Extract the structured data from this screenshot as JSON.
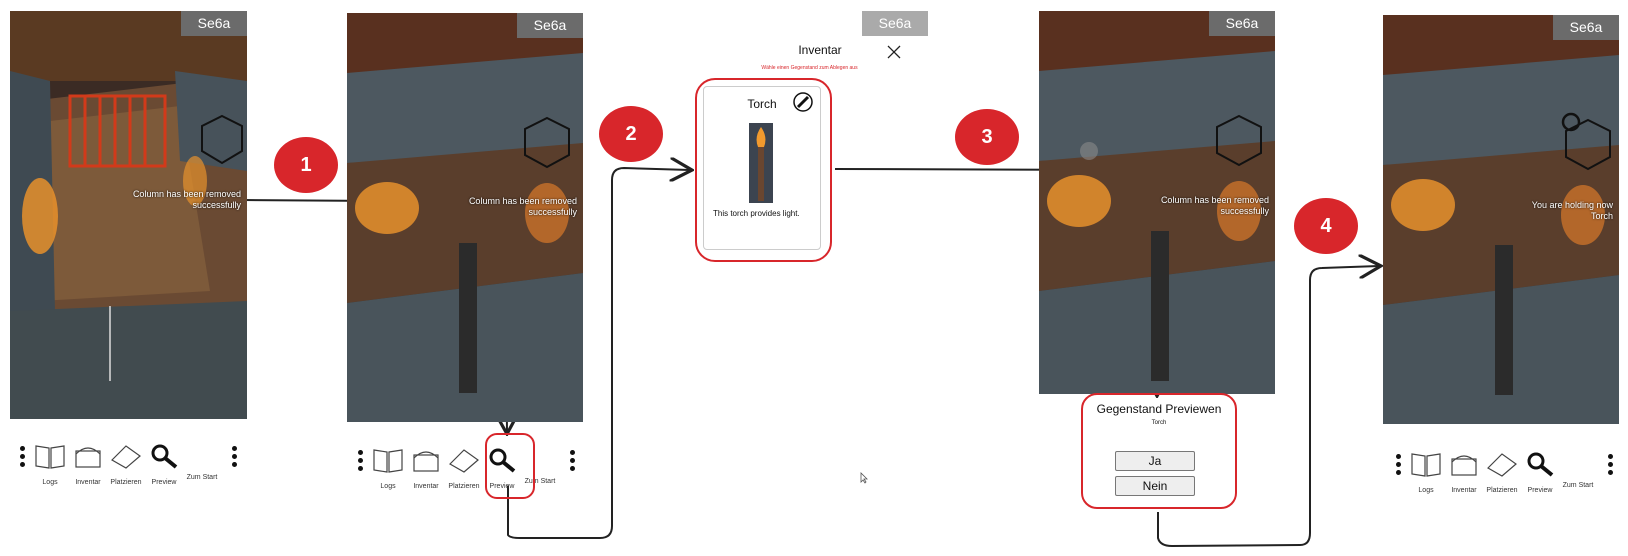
{
  "app_badge": "Se6a",
  "messages": {
    "column_removed": "Column has been removed successfully",
    "holding_torch": "You are holding now Torch"
  },
  "toolbar": {
    "logs": "Logs",
    "inventar": "Inventar",
    "platzieren": "Platzieren",
    "preview": "Preview",
    "zum_start": "Zum Start"
  },
  "steps": [
    "1",
    "2",
    "3",
    "4"
  ],
  "inventory": {
    "title": "Inventar",
    "hint": "Wähle einen Gegenstand zum Ablegen aus",
    "item_name": "Torch",
    "item_description": "This torch provides light."
  },
  "preview_dialog": {
    "title": "Gegenstand Previewen",
    "item": "Torch",
    "yes": "Ja",
    "no": "Nein"
  },
  "colors": {
    "accent_red": "#d8262b",
    "badge_gray": "#6b6b6b"
  }
}
